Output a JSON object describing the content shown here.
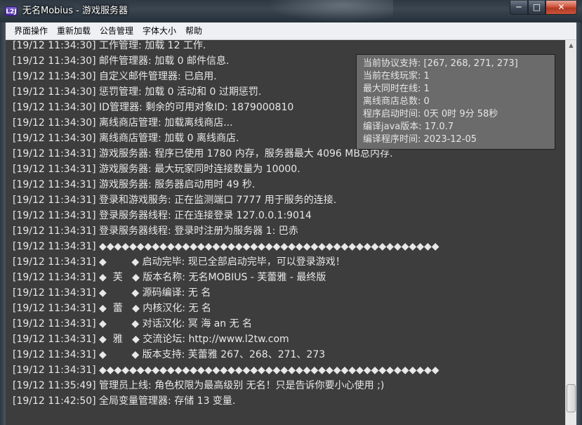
{
  "window": {
    "title": "无名Mobius - 游戏服务器",
    "icon_label": "L2J"
  },
  "titlebar_buttons": {
    "minimize": "─",
    "maximize": "□",
    "close": "✕"
  },
  "menu": [
    "界面操作",
    "重新加载",
    "公告管理",
    "字体大小",
    "帮助"
  ],
  "log_lines": [
    "[19/12 11:34:30] 工作管理: 加载 12 工作.",
    "[19/12 11:34:30] 邮件管理器: 加载 0 邮件信息.",
    "[19/12 11:34:30] 自定义邮件管理器: 已启用.",
    "[19/12 11:34:30] 惩罚管理: 加载 0 活动和 0 过期惩罚.",
    "[19/12 11:34:30] ID管理器: 剩余的可用对象ID: 1879000810",
    "[19/12 11:34:30] 离线商店管理: 加载离线商店...",
    "[19/12 11:34:30] 离线商店管理: 加载 0 离线商店.",
    "[19/12 11:34:31] 游戏服务器: 程序已使用 1780 内存，服务器最大 4096 MB总内存.",
    "[19/12 11:34:31] 游戏服务器: 最大玩家同时连接数量为 10000.",
    "[19/12 11:34:31] 游戏服务器: 服务器启动用时 49 秒.",
    "[19/12 11:34:31] 登录和游戏服务: 正在监测端口 7777 用于服务的连接.",
    "[19/12 11:34:31] 登录服务器线程: 正在连接登录 127.0.0.1:9014",
    "[19/12 11:34:31] 登录服务器线程: 登录时注册为服务器 1: 巴赤",
    "[19/12 11:34:31] ◆◆◆◆◆◆◆◆◆◆◆◆◆◆◆◆◆◆◆◆◆◆◆◆◆◆◆◆◆◆◆◆◆◆◆◆◆◆◆◆◆◆◆◆◆",
    "[19/12 11:34:31] ◆        ◆ 启动完毕: 现已全部启动完毕，可以登录游戏！",
    "[19/12 11:34:31] ◆  芙   ◆ 版本名称: 无名MOBIUS - 芙蕾雅 - 最终版",
    "[19/12 11:34:31] ◆        ◆ 源码编译: 无 名",
    "[19/12 11:34:31] ◆  蕾   ◆ 内核汉化: 无 名",
    "[19/12 11:34:31] ◆        ◆ 对话汉化: 冥 海 an 无 名",
    "[19/12 11:34:31] ◆  雅   ◆ 交流论坛: http://www.l2tw.com",
    "[19/12 11:34:31] ◆        ◆ 版本支持: 芙蕾雅 267、268、271、273",
    "[19/12 11:34:31] ◆◆◆◆◆◆◆◆◆◆◆◆◆◆◆◆◆◆◆◆◆◆◆◆◆◆◆◆◆◆◆◆◆◆◆◆◆◆◆◆◆◆◆◆◆",
    "[19/12 11:35:49] 管理员上线: 角色权限为最高级别 无名！只是告诉你要小心使用 ;)",
    "[19/12 11:42:50] 全局变量管理器: 存储 13 变量."
  ],
  "status_panel": [
    "当前协议支持: [267, 268, 271, 273]",
    "当前在线玩家: 1",
    "最大同时在线: 1",
    "离线商店总数: 0",
    "程序启动时间: 0天 0时 9分 58秒",
    "编译java版本: 17.0.7",
    "编译程序时间: 2023-12-05"
  ]
}
